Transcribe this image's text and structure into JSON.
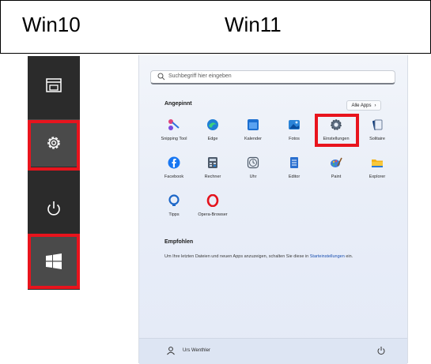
{
  "header": {
    "left_label": "Win10",
    "right_label": "Win11"
  },
  "win10": {
    "buttons": [
      {
        "name": "documents-icon",
        "highlighted": false
      },
      {
        "name": "gear-icon",
        "highlighted": true
      },
      {
        "name": "power-icon",
        "highlighted": false
      },
      {
        "name": "windows-logo-icon",
        "highlighted": true
      }
    ],
    "highlight_color": "#e8141d"
  },
  "win11": {
    "search": {
      "placeholder": "Suchbegriff hier eingeben"
    },
    "pinned": {
      "title": "Angepinnt",
      "all_apps_label": "Alle Apps",
      "apps": [
        {
          "label": "Snipping Tool",
          "icon": "snipping-tool-icon"
        },
        {
          "label": "Edge",
          "icon": "edge-icon"
        },
        {
          "label": "Kalender",
          "icon": "calendar-icon"
        },
        {
          "label": "Fotos",
          "icon": "photos-icon"
        },
        {
          "label": "Einstellungen",
          "icon": "settings-gear-icon",
          "highlighted": true
        },
        {
          "label": "Solitaire",
          "icon": "solitaire-icon"
        },
        {
          "label": "Facebook",
          "icon": "facebook-icon"
        },
        {
          "label": "Rechner",
          "icon": "calculator-icon"
        },
        {
          "label": "Uhr",
          "icon": "clock-icon"
        },
        {
          "label": "Editor",
          "icon": "notepad-icon"
        },
        {
          "label": "Paint",
          "icon": "paint-icon"
        },
        {
          "label": "Explorer",
          "icon": "folder-icon"
        },
        {
          "label": "Tipps",
          "icon": "tips-icon"
        },
        {
          "label": "Opera-Browser",
          "icon": "opera-icon"
        }
      ]
    },
    "recommended": {
      "title": "Empfohlen",
      "text": "Um Ihre letzten Dateien und neuen Apps anzuzeigen, schalten Sie diese in ",
      "link": "Starteinstellungen",
      "suffix": " ein."
    },
    "footer": {
      "user_name": "Urs Wenthler"
    }
  }
}
